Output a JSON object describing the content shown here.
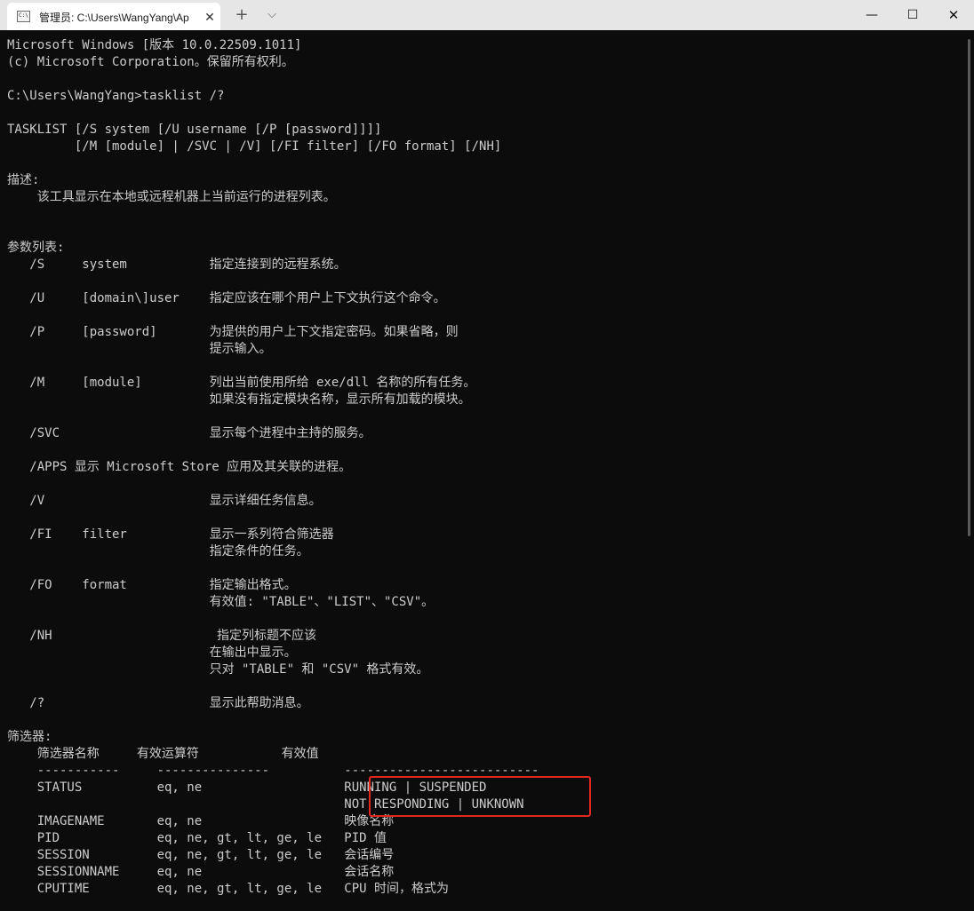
{
  "window": {
    "tab_icon_label": "C:\\",
    "tab_title": "管理员: C:\\Users\\WangYang\\Ap",
    "tab_close_glyph": "✕",
    "new_tab_glyph": "+",
    "dropdown_glyph": "⌵",
    "minimize_glyph": "—",
    "maximize_glyph": "☐",
    "close_glyph": "✕"
  },
  "console": {
    "lines": [
      "Microsoft Windows [版本 10.0.22509.1011]",
      "(c) Microsoft Corporation。保留所有权利。",
      "",
      "C:\\Users\\WangYang>tasklist /?",
      "",
      "TASKLIST [/S system [/U username [/P [password]]]]",
      "         [/M [module] | /SVC | /V] [/FI filter] [/FO format] [/NH]",
      "",
      "描述:",
      "    该工具显示在本地或远程机器上当前运行的进程列表。",
      "",
      "",
      "参数列表:",
      "   /S     system           指定连接到的远程系统。",
      "",
      "   /U     [domain\\]user    指定应该在哪个用户上下文执行这个命令。",
      "",
      "   /P     [password]       为提供的用户上下文指定密码。如果省略，则",
      "                           提示输入。",
      "",
      "   /M     [module]         列出当前使用所给 exe/dll 名称的所有任务。",
      "                           如果没有指定模块名称，显示所有加载的模块。",
      "",
      "   /SVC                    显示每个进程中主持的服务。",
      "",
      "   /APPS 显示 Microsoft Store 应用及其关联的进程。",
      "",
      "   /V                      显示详细任务信息。",
      "",
      "   /FI    filter           显示一系列符合筛选器",
      "                           指定条件的任务。",
      "",
      "   /FO    format           指定输出格式。",
      "                           有效值: \"TABLE\"、\"LIST\"、\"CSV\"。",
      "",
      "   /NH                      指定列标题不应该",
      "                           在输出中显示。",
      "                           只对 \"TABLE\" 和 \"CSV\" 格式有效。",
      "",
      "   /?                      显示此帮助消息。",
      "",
      "筛选器:",
      "    筛选器名称     有效运算符           有效值",
      "    -----------     ---------------          --------------------------",
      "    STATUS          eq, ne                   RUNNING | SUSPENDED",
      "                                             NOT RESPONDING | UNKNOWN",
      "    IMAGENAME       eq, ne                   映像名称",
      "    PID             eq, ne, gt, lt, ge, le   PID 值",
      "    SESSION         eq, ne, gt, lt, ge, le   会话编号",
      "    SESSIONNAME     eq, ne                   会话名称",
      "    CPUTIME         eq, ne, gt, lt, ge, le   CPU 时间，格式为"
    ]
  }
}
